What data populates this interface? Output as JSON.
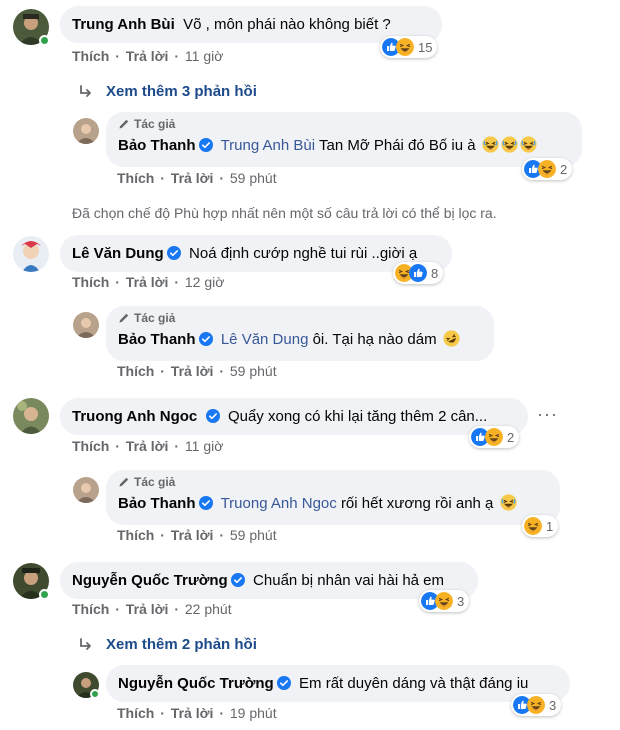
{
  "author_tag_label": "Tác giả",
  "action_like": "Thích",
  "action_reply": "Trả lời",
  "separator": "·",
  "filter_notice": "Đã chọn chế độ Phù hợp nhất nên một số câu trả lời có thể bị lọc ra.",
  "comments": [
    {
      "name": "Trung Anh Bùi",
      "text": "Võ , môn phái nào không biết ?",
      "time": "11 giờ",
      "reaction_count": "15",
      "see_more": "Xem thêm 3 phản hồi",
      "reply": {
        "name": "Bảo Thanh",
        "mention": "Trung Anh Bùi",
        "text": "Tan Mỡ Phái đó Bố iu à",
        "time": "59 phút",
        "reaction_count": "2"
      }
    },
    {
      "name": "Lê Văn Dung",
      "text": "Noá định cướp nghề tui rùi ..giời ạ",
      "time": "12 giờ",
      "reaction_count": "8",
      "reply": {
        "name": "Bảo Thanh",
        "mention": "Lê Văn Dung",
        "text": "ôi. Tại hạ nào dám",
        "time": "59 phút"
      }
    },
    {
      "name": "Truong Anh Ngoc",
      "text": "Quẩy xong có khi lại tăng thêm 2 cân...",
      "time": "11 giờ",
      "reaction_count": "2",
      "more": "···",
      "reply": {
        "name": "Bảo Thanh",
        "mention": "Truong Anh Ngoc",
        "text": "rối hết xương rồi anh ạ",
        "time": "59 phút",
        "reaction_count": "1"
      }
    },
    {
      "name": "Nguyễn Quốc Trường",
      "text": "Chuẩn bị nhân vai hài hả em",
      "time": "22 phút",
      "reaction_count": "3",
      "see_more": "Xem thêm 2 phản hồi",
      "reply": {
        "name": "Nguyễn Quốc Trường",
        "text": "Em rất duyên dáng và thật đáng iu",
        "time": "19 phút",
        "reaction_count": "3"
      }
    }
  ],
  "colors": {
    "bubble": "#f0f2f5",
    "link": "#385898",
    "meta": "#65676b",
    "verified": "#1877f2",
    "online": "#31a24c"
  }
}
